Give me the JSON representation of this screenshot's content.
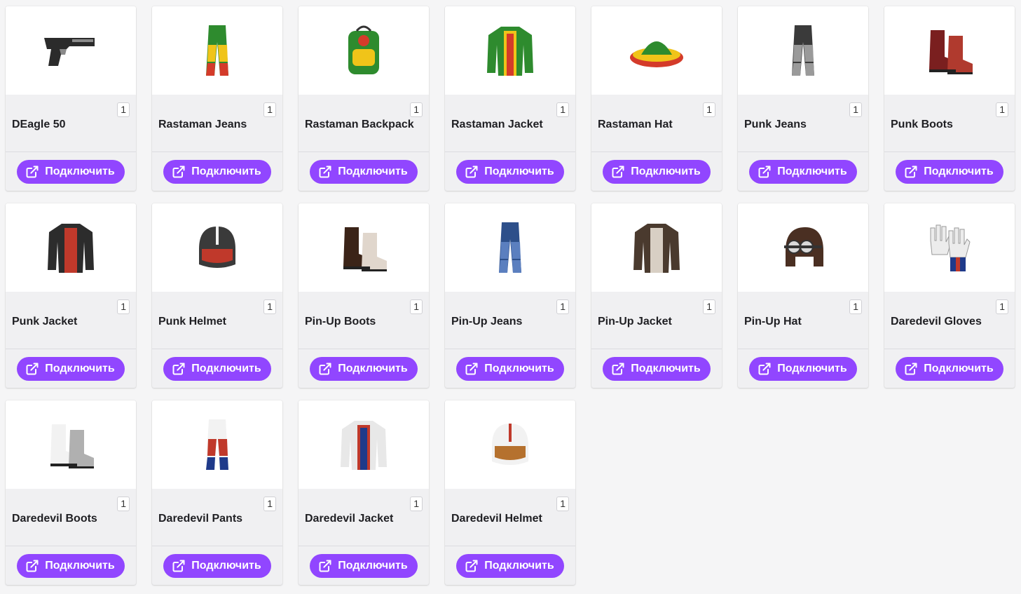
{
  "button_label": "Подключить",
  "accent": "#9146ff",
  "items": [
    {
      "name": "DEagle 50",
      "qty": "1",
      "icon": "pistol-icon",
      "colors": [
        "#2b2b2b",
        "#8a8a8a"
      ]
    },
    {
      "name": "Rastaman Jeans",
      "qty": "1",
      "icon": "jeans-icon",
      "colors": [
        "#2e8b2e",
        "#f0c419",
        "#d43b2a"
      ]
    },
    {
      "name": "Rastaman Backpack",
      "qty": "1",
      "icon": "backpack-icon",
      "colors": [
        "#2e8b2e",
        "#f0c419",
        "#d43b2a"
      ]
    },
    {
      "name": "Rastaman Jacket",
      "qty": "1",
      "icon": "jacket-icon",
      "colors": [
        "#2e8b2e",
        "#f0c419",
        "#d43b2a"
      ]
    },
    {
      "name": "Rastaman Hat",
      "qty": "1",
      "icon": "hat-icon",
      "colors": [
        "#2e8b2e",
        "#f0c419",
        "#d43b2a"
      ]
    },
    {
      "name": "Punk Jeans",
      "qty": "1",
      "icon": "jeans-icon",
      "colors": [
        "#3a3a3a",
        "#9a9a9a"
      ]
    },
    {
      "name": "Punk Boots",
      "qty": "1",
      "icon": "boots-icon",
      "colors": [
        "#7a1f1f",
        "#b03a2e"
      ]
    },
    {
      "name": "Punk Jacket",
      "qty": "1",
      "icon": "jacket-icon",
      "colors": [
        "#2c2c2c",
        "#c0392b"
      ]
    },
    {
      "name": "Punk Helmet",
      "qty": "1",
      "icon": "helmet-icon",
      "colors": [
        "#3a3a3a",
        "#f2f2f2",
        "#c0392b"
      ]
    },
    {
      "name": "Pin-Up Boots",
      "qty": "1",
      "icon": "boots-icon",
      "colors": [
        "#3b2418",
        "#e0d6cc"
      ]
    },
    {
      "name": "Pin-Up Jeans",
      "qty": "1",
      "icon": "jeans-icon",
      "colors": [
        "#2d4f8a",
        "#5b7fbf"
      ]
    },
    {
      "name": "Pin-Up Jacket",
      "qty": "1",
      "icon": "jacket-icon",
      "colors": [
        "#4a3a2e",
        "#d8cfc4"
      ]
    },
    {
      "name": "Pin-Up Hat",
      "qty": "1",
      "icon": "aviator-hat-icon",
      "colors": [
        "#4a2f22",
        "#d9d9d9"
      ]
    },
    {
      "name": "Daredevil Gloves",
      "qty": "1",
      "icon": "gloves-icon",
      "colors": [
        "#ececec",
        "#c0392b",
        "#1f3a8a"
      ]
    },
    {
      "name": "Daredevil Boots",
      "qty": "1",
      "icon": "boots-icon",
      "colors": [
        "#f2f2f2",
        "#b0b0b0"
      ]
    },
    {
      "name": "Daredevil Pants",
      "qty": "1",
      "icon": "jeans-icon",
      "colors": [
        "#f2f2f2",
        "#c0392b",
        "#1f3a8a"
      ]
    },
    {
      "name": "Daredevil Jacket",
      "qty": "1",
      "icon": "jacket-icon",
      "colors": [
        "#e8e8e8",
        "#c0392b",
        "#1f3a8a"
      ]
    },
    {
      "name": "Daredevil Helmet",
      "qty": "1",
      "icon": "helmet-icon",
      "colors": [
        "#f2f2f2",
        "#c0392b",
        "#b5712e"
      ]
    }
  ]
}
